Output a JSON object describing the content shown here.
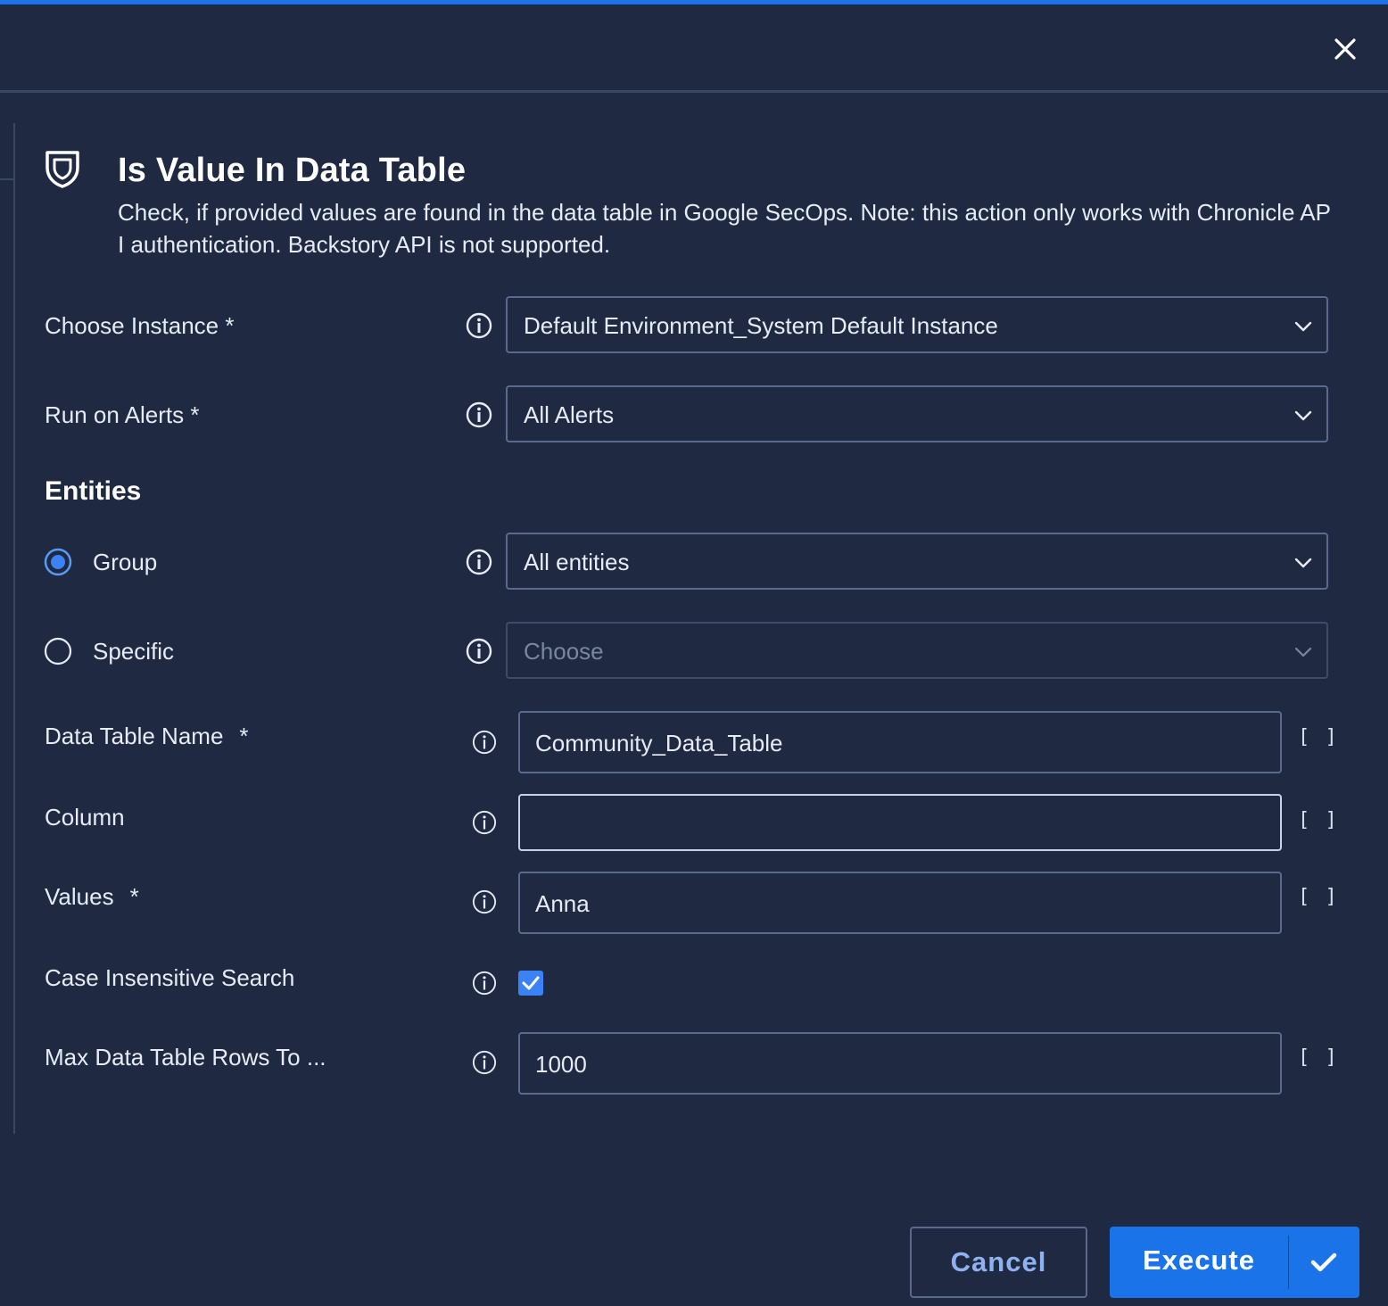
{
  "colors": {
    "background": "#1f2a42",
    "accent": "#1a73e8",
    "border": "#5b6a8c",
    "checkbox": "#3b82f6"
  },
  "header": {
    "close_icon": "close-icon"
  },
  "action": {
    "icon": "shield-icon",
    "title": "Is Value In Data Table",
    "description": "Check, if provided values are found in the data table in Google SecOps. Note: this action only works with Chronicle AP I authentication. Backstory API is not supported."
  },
  "fields": {
    "instance": {
      "label": "Choose Instance *",
      "value": "Default Environment_System Default Instance"
    },
    "alerts": {
      "label": "Run on Alerts *",
      "value": "All Alerts"
    },
    "entities": {
      "section_title": "Entities",
      "group": {
        "label": "Group",
        "value": "All entities",
        "selected": true
      },
      "specific": {
        "label": "Specific",
        "placeholder": "Choose",
        "selected": false
      }
    },
    "data_table_name": {
      "label": "Data Table Name",
      "required": "*",
      "value": "Community_Data_Table"
    },
    "column": {
      "label": "Column",
      "value": ""
    },
    "values": {
      "label": "Values",
      "required": "*",
      "value": "Anna"
    },
    "case_insensitive": {
      "label": "Case Insensitive Search",
      "checked": true
    },
    "max_rows": {
      "label": "Max Data Table Rows To ...",
      "value": "1000"
    },
    "placeholder_button": "[ ]"
  },
  "footer": {
    "cancel_label": "Cancel",
    "execute_label": "Execute"
  }
}
